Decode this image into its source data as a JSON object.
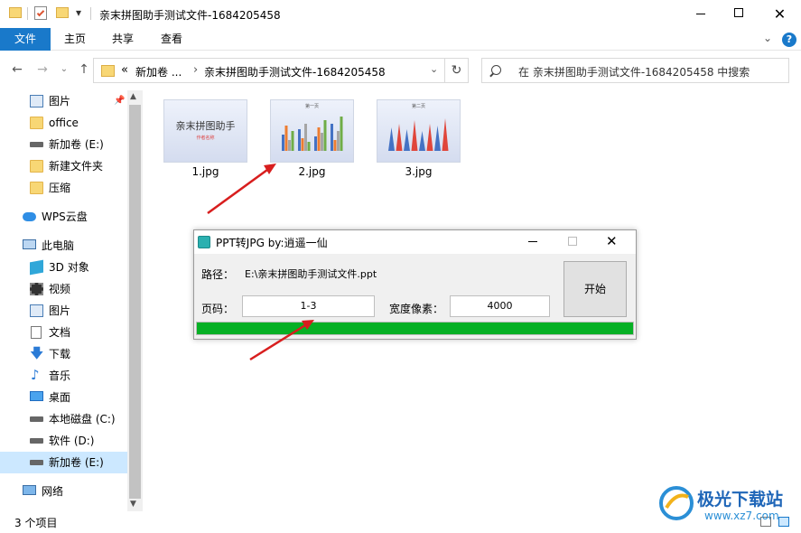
{
  "window": {
    "title": "亲末拼图助手测试文件-1684205458",
    "qat_dropdown": "▾"
  },
  "ribbon": {
    "tabs": [
      {
        "label": "文件"
      },
      {
        "label": "主页"
      },
      {
        "label": "共享"
      },
      {
        "label": "查看"
      }
    ]
  },
  "address": {
    "prefix": "«",
    "parent": "新加卷 ...",
    "sep": "›",
    "current": "亲末拼图助手测试文件-1684205458",
    "search_placeholder": "在 亲末拼图助手测试文件-1684205458 中搜索"
  },
  "sidebar": {
    "quick_access": [
      {
        "label": "图片",
        "icon": "pictures-icon"
      },
      {
        "label": "office",
        "icon": "folder-icon"
      },
      {
        "label": "新加卷 (E:)",
        "icon": "drive-icon"
      },
      {
        "label": "新建文件夹",
        "icon": "folder-icon"
      },
      {
        "label": "压缩",
        "icon": "folder-icon"
      }
    ],
    "wps": "WPS云盘",
    "this_pc": "此电脑",
    "pc_items": [
      {
        "label": "3D 对象",
        "icon": "3d-objects-icon"
      },
      {
        "label": "视频",
        "icon": "videos-icon"
      },
      {
        "label": "图片",
        "icon": "pictures-icon"
      },
      {
        "label": "文档",
        "icon": "documents-icon"
      },
      {
        "label": "下载",
        "icon": "downloads-icon"
      },
      {
        "label": "音乐",
        "icon": "music-icon"
      },
      {
        "label": "桌面",
        "icon": "desktop-icon"
      },
      {
        "label": "本地磁盘 (C:)",
        "icon": "drive-icon"
      },
      {
        "label": "软件 (D:)",
        "icon": "drive-icon"
      },
      {
        "label": "新加卷 (E:)",
        "icon": "drive-icon"
      }
    ],
    "network": "网络"
  },
  "files": [
    {
      "name": "1.jpg",
      "slide_title": "亲末拼图助手",
      "slide_sub": "作者名称"
    },
    {
      "name": "2.jpg",
      "slide_title": "第一页"
    },
    {
      "name": "3.jpg",
      "slide_title": "第二页"
    }
  ],
  "dialog": {
    "title": "PPT转JPG  by:逍遥一仙",
    "path_label": "路径：",
    "path_value": "E:\\亲末拼图助手测试文件.ppt",
    "page_label": "页码：",
    "page_value": "1-3",
    "width_label": "宽度像素：",
    "width_value": "4000",
    "start_button": "开始",
    "progress": 1.0
  },
  "status": {
    "count": "3 个项目"
  },
  "watermark": {
    "brand": "极光下载站",
    "url": "www.xz7.com"
  },
  "colors": {
    "accent": "#1979ca",
    "progress": "#06b025",
    "arrow": "#d81e1e"
  }
}
